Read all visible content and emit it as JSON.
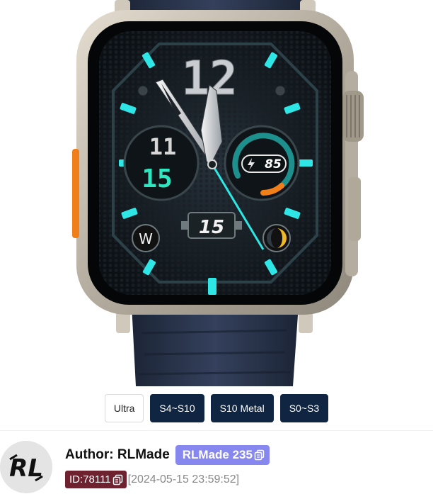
{
  "watch_face": {
    "hour_numeral": "12",
    "time_hours": "11",
    "time_minutes": "15",
    "battery_value": "85",
    "date_day": "15",
    "compass_letter": "W"
  },
  "models": [
    {
      "label": "Ultra",
      "active": true
    },
    {
      "label": "S4~S10",
      "active": false
    },
    {
      "label": "S10 Metal",
      "active": false
    },
    {
      "label": "S0~S3",
      "active": false
    }
  ],
  "author": {
    "avatar_text": "RL",
    "label": "Author: RLMade",
    "badge": "RLMade 235"
  },
  "item": {
    "id": "ID:78111",
    "date": "[2024-05-15 23:59:52]"
  },
  "colors": {
    "accent_cyan": "#2ee6e6",
    "gauge_orange": "#f07f1a",
    "model_button_dark": "#0f2542",
    "author_badge": "#8787f0",
    "id_badge": "#6e2230"
  }
}
